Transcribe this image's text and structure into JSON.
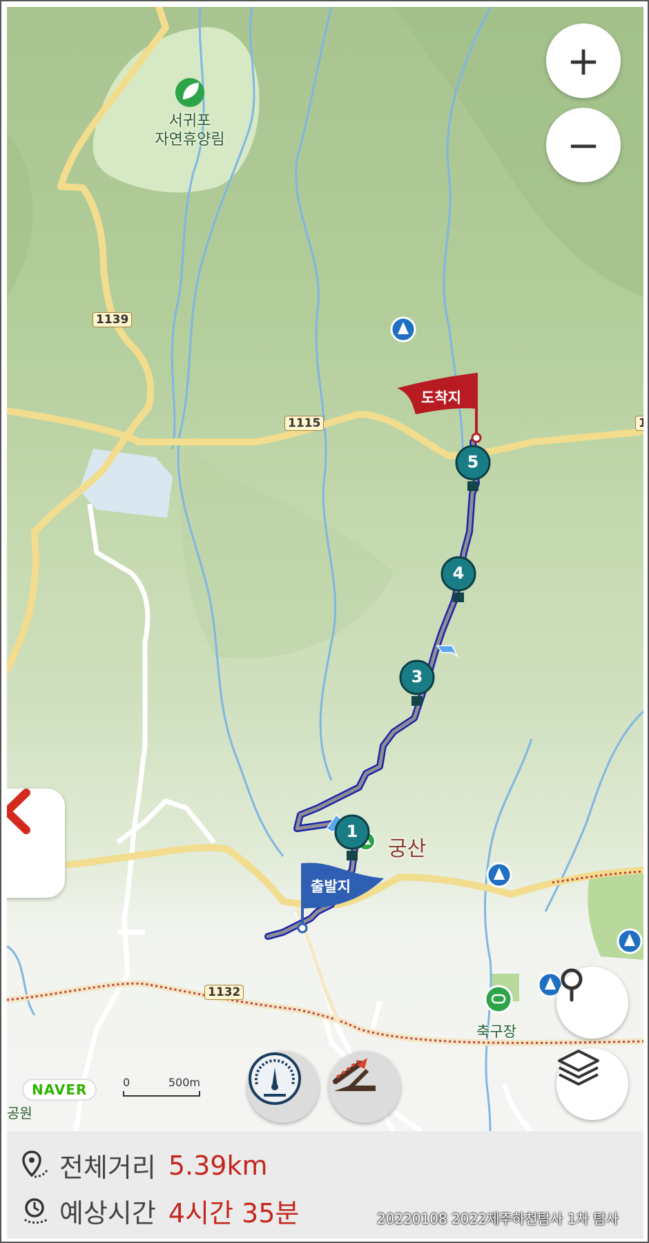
{
  "map": {
    "place_labels": {
      "forest": "서귀포\n자연휴양림",
      "mountain": "궁산",
      "soccer_field": "축구장"
    },
    "road_labels": [
      "1139",
      "1115",
      "1132",
      "1"
    ],
    "flags": {
      "start": "출발지",
      "end": "도착지"
    },
    "waypoints": [
      "1",
      "3",
      "4",
      "5"
    ],
    "scale": {
      "zero": "0",
      "distance": "500m"
    },
    "brand": "NAVER",
    "edge_fragment": "공원",
    "route_color": "#1c23a8",
    "start_flag_color": "#2f5fb3",
    "end_flag_color": "#b81c22",
    "waypoint_color": "#1a7d86"
  },
  "controls": {
    "zoom_in": "+",
    "zoom_out": "−"
  },
  "info": {
    "distance_label": "전체거리",
    "distance_value": "5.39km",
    "time_label": "예상시간",
    "time_value": "4시간 35분",
    "value_color": "#c4261d"
  },
  "watermark": "20220108 2022제주하천탐사 1차 탐사"
}
